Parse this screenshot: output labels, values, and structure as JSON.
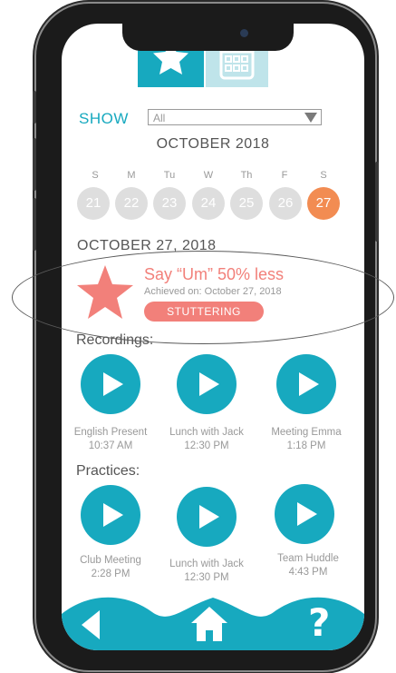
{
  "header": {
    "tabs": [
      {
        "name": "achievements",
        "icon": "star-icon"
      },
      {
        "name": "calendar",
        "icon": "calendar-icon"
      }
    ]
  },
  "filter": {
    "label": "SHOW",
    "value": "All"
  },
  "calendar": {
    "month": "OCTOBER 2018",
    "weekdays": [
      "S",
      "M",
      "Tu",
      "W",
      "Th",
      "F",
      "S"
    ],
    "days": [
      "21",
      "22",
      "23",
      "24",
      "25",
      "26",
      "27"
    ],
    "selected_day": "27"
  },
  "selected_date": "OCTOBER 27, 2018",
  "achievement": {
    "title": "Say “Um” 50% less",
    "subtitle": "Achieved on: October 27, 2018",
    "tag": "STUTTERING"
  },
  "recordings": {
    "heading": "Recordings:",
    "items": [
      {
        "title": "English Present",
        "time": "10:37 AM"
      },
      {
        "title": "Lunch with Jack",
        "time": "12:30 PM"
      },
      {
        "title": "Meeting Emma",
        "time": "1:18 PM"
      }
    ]
  },
  "practices": {
    "heading": "Practices:",
    "items": [
      {
        "title": "Club Meeting",
        "time": "2:28 PM"
      },
      {
        "title": "Lunch with Jack",
        "time": "12:30 PM"
      },
      {
        "title": "Team Huddle",
        "time": "4:43 PM"
      }
    ]
  },
  "nav": {
    "back": "back-icon",
    "home": "home-icon",
    "help": "?"
  },
  "colors": {
    "accent": "#17a9bf",
    "accent_light": "#bfe4ea",
    "highlight": "#f2807a",
    "selected_day": "#f28c52",
    "day_inactive": "#dedede"
  }
}
